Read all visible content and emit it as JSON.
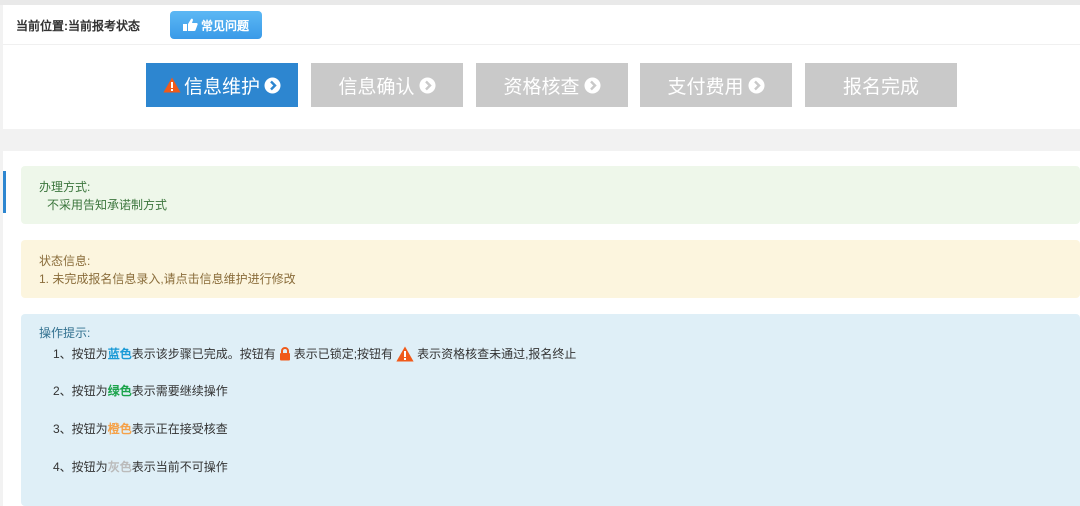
{
  "breadcrumb": {
    "label": "当前位置:",
    "current": "当前报考状态"
  },
  "faq_button": {
    "label": "常见问题",
    "icon": "pointing-hand-icon"
  },
  "steps": [
    {
      "label": "信息维护",
      "state": "active",
      "warning_icon": "warning-icon",
      "arrow_icon": "chevron-circle-right-icon"
    },
    {
      "label": "信息确认",
      "state": "disabled",
      "arrow_icon": "chevron-circle-right-icon"
    },
    {
      "label": "资格核查",
      "state": "disabled",
      "arrow_icon": "chevron-circle-right-icon"
    },
    {
      "label": "支付费用",
      "state": "disabled",
      "arrow_icon": "chevron-circle-right-icon"
    },
    {
      "label": "报名完成",
      "state": "disabled"
    }
  ],
  "method_panel": {
    "title": "办理方式:",
    "text": "不采用告知承诺制方式"
  },
  "status_panel": {
    "title": "状态信息:",
    "text": "1. 未完成报名信息录入,请点击信息维护进行修改"
  },
  "tips_panel": {
    "title": "操作提示:",
    "tip1": {
      "prefix": "1、按钮为",
      "color_word": "蓝色",
      "mid": "表示该步骤已完成。按钮有",
      "lock_icon": "lock-icon",
      "locked_text": "表示已锁定;按钮有",
      "warning_icon": "warning-icon",
      "suffix": "表示资格核查未通过,报名终止"
    },
    "tip2": {
      "prefix": "2、按钮为",
      "color_word": "绿色",
      "suffix": "表示需要继续操作"
    },
    "tip3": {
      "prefix": "3、按钮为",
      "color_word": "橙色",
      "suffix": "表示正在接受核查"
    },
    "tip4": {
      "prefix": "4、按钮为",
      "color_word": "灰色",
      "suffix": "表示当前不可操作"
    }
  },
  "colors": {
    "active_step": "#2d86d0",
    "disabled_step": "#c9c9c9",
    "blue": "#1a9ad6",
    "green": "#1aa34a",
    "orange": "#f5a24a",
    "grey": "#bbbbbb",
    "warning": "#f05a1a",
    "lock": "#f05a1a"
  }
}
